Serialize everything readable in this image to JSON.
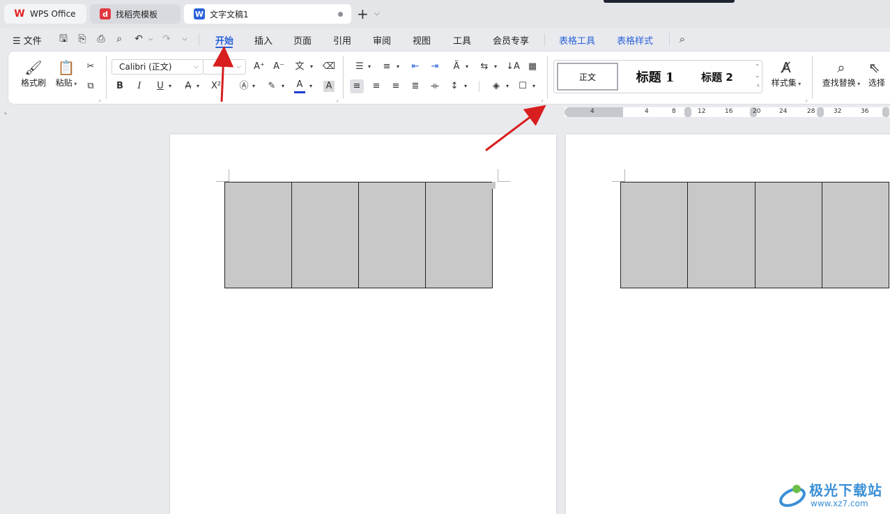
{
  "tabs": [
    {
      "label": "WPS Office",
      "icon": "wps-logo-icon"
    },
    {
      "label": "找稻壳模板",
      "icon": "docer-icon"
    },
    {
      "label": "文字文稿1",
      "icon": "writer-doc-icon",
      "active": true,
      "unsaved": true
    }
  ],
  "menu": {
    "file": "文件",
    "tabs": [
      "开始",
      "插入",
      "页面",
      "引用",
      "审阅",
      "视图",
      "工具",
      "会员专享"
    ],
    "context_tabs": [
      "表格工具",
      "表格样式"
    ],
    "active_tab": "开始"
  },
  "ribbon": {
    "clipboard": {
      "format_painter": "格式刷",
      "paste": "粘贴"
    },
    "font": {
      "name": "Calibri (正文)",
      "size": ""
    },
    "styles": {
      "normal": "正文",
      "heading1": "标题  1",
      "heading2": "标题  2",
      "style_set": "样式集"
    },
    "editing": {
      "find_replace": "查找替换",
      "select": "选择"
    }
  },
  "ruler": {
    "numbers": [
      "4",
      "4",
      "8",
      "12",
      "16",
      "20",
      "24",
      "28",
      "32",
      "36"
    ]
  },
  "document": {
    "pages": 2,
    "table": {
      "rows": 1,
      "cols": 4,
      "cell_fill": "#c8c8c8"
    }
  },
  "annotations": [
    {
      "type": "red-arrow",
      "target": "开始 tab"
    },
    {
      "type": "red-arrow",
      "target": "paragraph settings launcher"
    }
  ],
  "watermark": {
    "brand": "极光下载站",
    "url": "www.xz7.com"
  },
  "colors": {
    "accent": "#2b62d9",
    "arrow": "#d81e1e",
    "font_color_bar": "#1f3bd6"
  }
}
